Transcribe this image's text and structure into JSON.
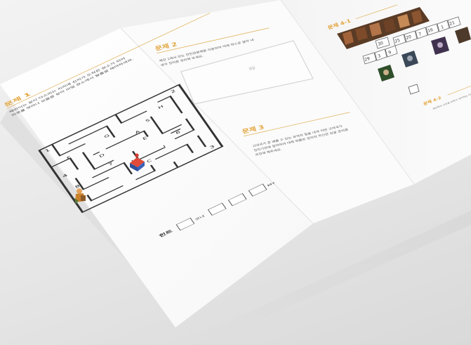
{
  "brochure": {
    "q1_title": "문제 1",
    "q1_text_line1": "재민이는 왕이 다스리는 지리에 친지가 도착한 장소가 되어",
    "q1_text_line2": "미로를 벗어나 보물을 찾아 비밀 장소에서 탈출을 해야하세요.",
    "q2_title": "문제 2",
    "q2_text_line1": "제안 1에서 있는 만인감분해를 이용하여 아래 박스로 알아 내",
    "q2_text_line2": "생각 정리를 정리해 보세요.",
    "q2_box_placeholder": "정답",
    "q3_title": "문제 3",
    "q3_text_line1": "고대국가 중 배울 수 있는 유적의 일을 내게 이번 고대국가",
    "q3_text_line2": "정치기관에 참여하여 대해 박물관 정리의 최신판 있을 준비를",
    "q3_text_line3": "과정에 해주세요.",
    "q4_1_title": "문제 4-1",
    "q4_2_title": "문제 4-2",
    "q4_numbers_row1": [
      "30"
    ],
    "q4_numbers_row2": [
      "29",
      "3",
      "9",
      "25",
      "20",
      "7",
      "16",
      "1",
      "21"
    ],
    "q4_2_text": "제안에서 사진을 보면서 생각하는 다양한",
    "hint_label": "힌트",
    "hint_words": [
      "코너",
      "MY"
    ],
    "maze_labels": [
      "1",
      "2",
      "3",
      "4",
      "5",
      "6",
      "7",
      "A",
      "B",
      "C",
      "D",
      "E",
      "F",
      "G",
      "H",
      "I",
      "J"
    ]
  }
}
